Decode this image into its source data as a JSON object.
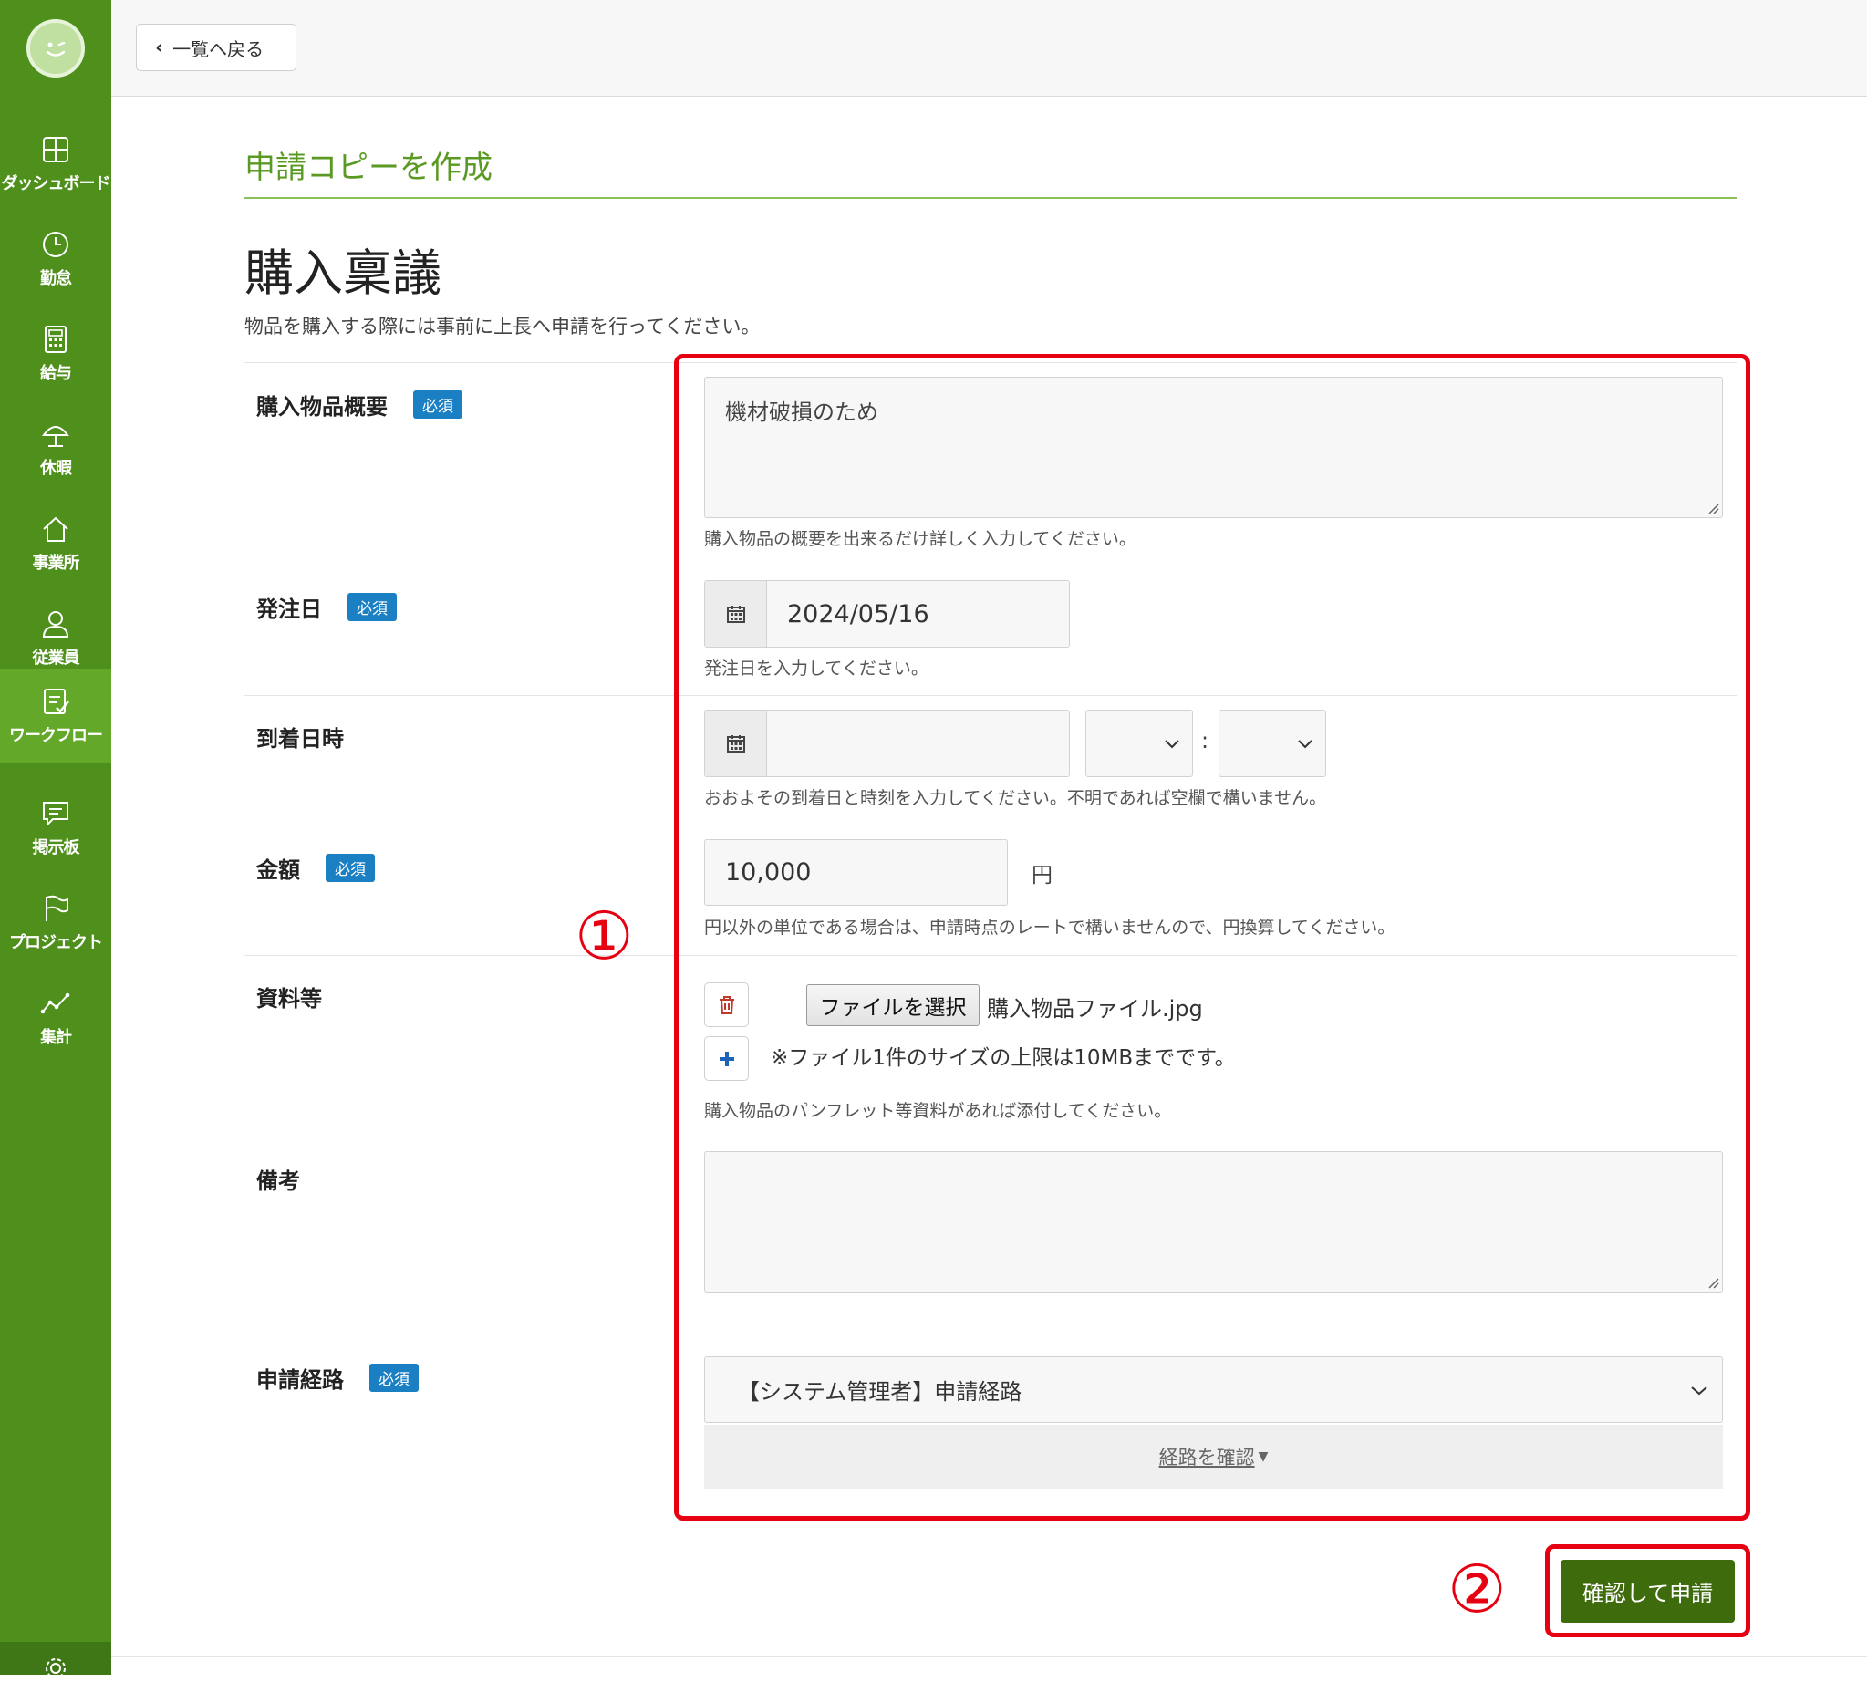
{
  "sidebar": {
    "items": [
      {
        "label": "ダッシュボード",
        "icon": "dashboard-icon"
      },
      {
        "label": "勤怠",
        "icon": "clock-icon"
      },
      {
        "label": "給与",
        "icon": "calculator-icon"
      },
      {
        "label": "休暇",
        "icon": "umbrella-icon"
      },
      {
        "label": "事業所",
        "icon": "home-icon"
      },
      {
        "label": "従業員",
        "icon": "user-icon"
      },
      {
        "label": "ワークフロー",
        "icon": "checklist-icon",
        "active": true
      },
      {
        "label": "掲示板",
        "icon": "chat-icon"
      },
      {
        "label": "プロジェクト",
        "icon": "flag-icon"
      },
      {
        "label": "集計",
        "icon": "line-chart-icon"
      }
    ]
  },
  "topbar": {
    "back_label": "一覧へ戻る"
  },
  "page": {
    "title": "申請コピーを作成",
    "form_title": "購入稟議",
    "form_desc": "物品を購入する際には事前に上長へ申請を行ってください。"
  },
  "required_badge": "必須",
  "fields": {
    "summary": {
      "label": "購入物品概要",
      "value": "機材破損のため",
      "help": "購入物品の概要を出来るだけ詳しく入力してください。"
    },
    "order_date": {
      "label": "発注日",
      "value": "2024/05/16",
      "help": "発注日を入力してください。"
    },
    "arrival": {
      "label": "到着日時",
      "value": "",
      "colon": ":",
      "help": "おおよその到着日と時刻を入力してください。不明であれば空欄で構いません。"
    },
    "amount": {
      "label": "金額",
      "value": "10,000",
      "unit": "円",
      "help": "円以外の単位である場合は、申請時点のレートで構いませんので、円換算してください。"
    },
    "attachments": {
      "label": "資料等",
      "file_button": "ファイルを選択",
      "file_name": "購入物品ファイル.jpg",
      "note": "※ファイル1件のサイズの上限は10MBまでです。",
      "help": "購入物品のパンフレット等資料があれば添付してください。"
    },
    "remarks": {
      "label": "備考",
      "value": ""
    },
    "route": {
      "label": "申請経路",
      "value": "【システム管理者】申請経路",
      "confirm_label": "経路を確認"
    }
  },
  "submit_label": "確認して申請",
  "annotations": {
    "one": "①",
    "two": "②",
    "color": "#e60012"
  },
  "colors": {
    "sidebar": "#4f8f1c",
    "accent": "#5a9a23",
    "badge": "#1b7fc4",
    "submit": "#3e6b0c"
  }
}
